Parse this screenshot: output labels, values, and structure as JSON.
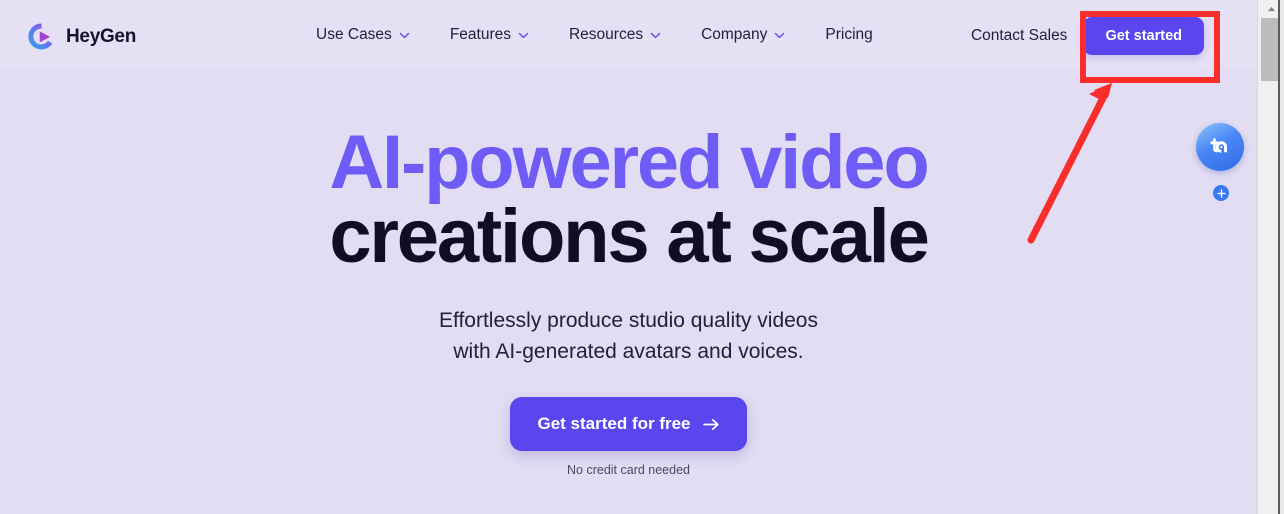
{
  "browser": {
    "scrollbar": {
      "up_arrow_icon": "triangle-up-icon",
      "thumb_label": "scrollbar-thumb"
    }
  },
  "colors": {
    "page_background": "#e3ddf3",
    "header_background": "#e5e0f4",
    "accent_purple": "#5b45ef",
    "heading_purple": "#6f5bf5",
    "heading_dark": "#100d26",
    "annotation_red": "#fa2d2d",
    "widget_blue": "#3a7bf0"
  },
  "header": {
    "brand": {
      "name": "HeyGen",
      "logo_icon": "heygen-play-swirl-logo"
    },
    "nav_items": [
      {
        "label": "Use Cases",
        "icon": "chevron-down-icon",
        "has_dropdown": true
      },
      {
        "label": "Features",
        "icon": "chevron-down-icon",
        "has_dropdown": true
      },
      {
        "label": "Resources",
        "icon": "chevron-down-icon",
        "has_dropdown": true
      },
      {
        "label": "Company",
        "icon": "chevron-down-icon",
        "has_dropdown": true
      },
      {
        "label": "Pricing",
        "icon": "",
        "has_dropdown": false
      }
    ],
    "contact_sales_label": "Contact Sales",
    "get_started_label": "Get started"
  },
  "hero": {
    "title_line1": "AI-powered video",
    "title_line2": "creations at scale",
    "subtitle_line1": "Effortlessly produce studio quality videos",
    "subtitle_line2": "with AI-generated avatars and voices.",
    "cta_label": "Get started for free",
    "cta_icon": "arrow-right-icon",
    "cta_note": "No credit card needed"
  },
  "widget": {
    "bubble_icon": "chat-assistant-icon",
    "plus_icon": "plus-icon"
  },
  "annotation": {
    "highlight_target": "Get started",
    "box_color": "#fa2d2d",
    "arrow_color": "#fa2d2d",
    "arrow_from": "1032,238",
    "arrow_to": "1112,84"
  }
}
